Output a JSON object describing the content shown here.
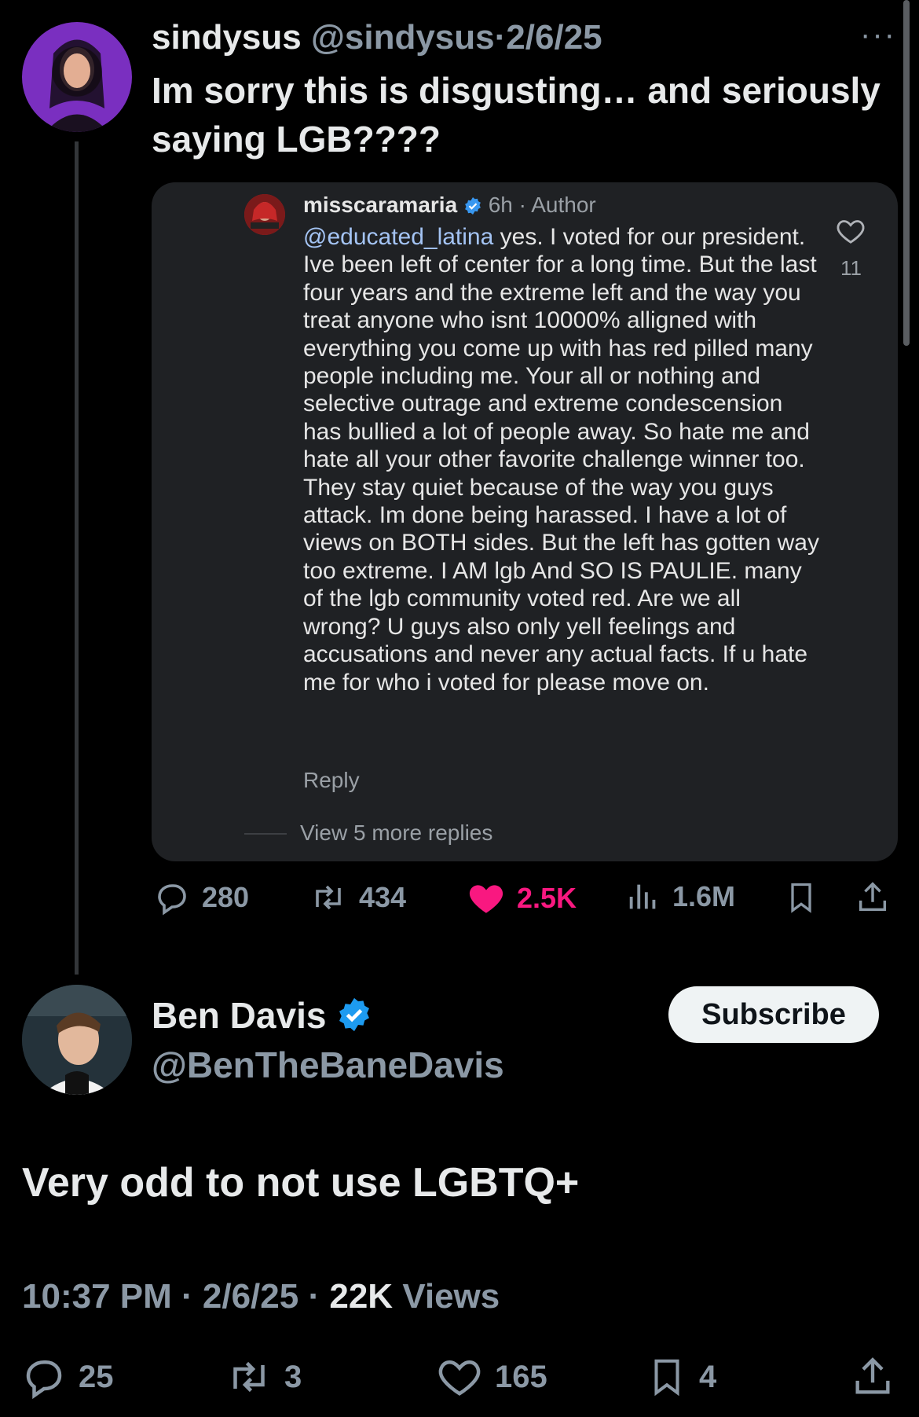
{
  "quoted_tweet": {
    "display_name": "sindysus",
    "handle": "@sindysus",
    "separator": "·",
    "date": "2/6/25",
    "more": "···",
    "text": "Im sorry this is disgusting… and seriously saying LGB????",
    "embed": {
      "username": "misscaramaria",
      "time": "6h",
      "role_sep": "·",
      "role": "Author",
      "mention": "@educated_latina",
      "comment": " yes. I voted for our president. Ive been left of center for a long time. But the last four years and the extreme left and the way you treat anyone who isnt 10000% alligned with everything you come up with has red pilled many people including me. Your all or nothing and selective outrage and extreme condescension has bullied a lot of people away.  So hate me and hate all your other favorite challenge winner too. They stay quiet because of the way you guys attack. Im done being harassed. I have a lot of views on BOTH sides. But the left has gotten way too extreme. I AM lgb And SO IS PAULIE. many of the lgb community voted red. Are we all wrong? U guys also only yell feelings and accusations and never any actual facts. If u hate me for who i voted for please move on.",
      "likes": "11",
      "reply_label": "Reply",
      "view_more": "View 5 more replies"
    },
    "actions": {
      "replies": "280",
      "reposts": "434",
      "likes": "2.5K",
      "views": "1.6M"
    }
  },
  "main_tweet": {
    "display_name": "Ben Davis",
    "handle": "@BenTheBaneDavis",
    "subscribe_label": "Subscribe",
    "text": "Very odd to not use LGBTQ+",
    "time": "10:37 PM",
    "sep": "·",
    "date": "2/6/25",
    "views_count": "22K",
    "views_label": "Views",
    "actions": {
      "replies": "25",
      "reposts": "3",
      "likes": "165",
      "bookmarks": "4"
    }
  },
  "colors": {
    "background": "#000000",
    "text": "#e7e9ea",
    "muted": "#8b98a5",
    "like_pink": "#f91880",
    "verified_blue": "#1d9bf0"
  }
}
